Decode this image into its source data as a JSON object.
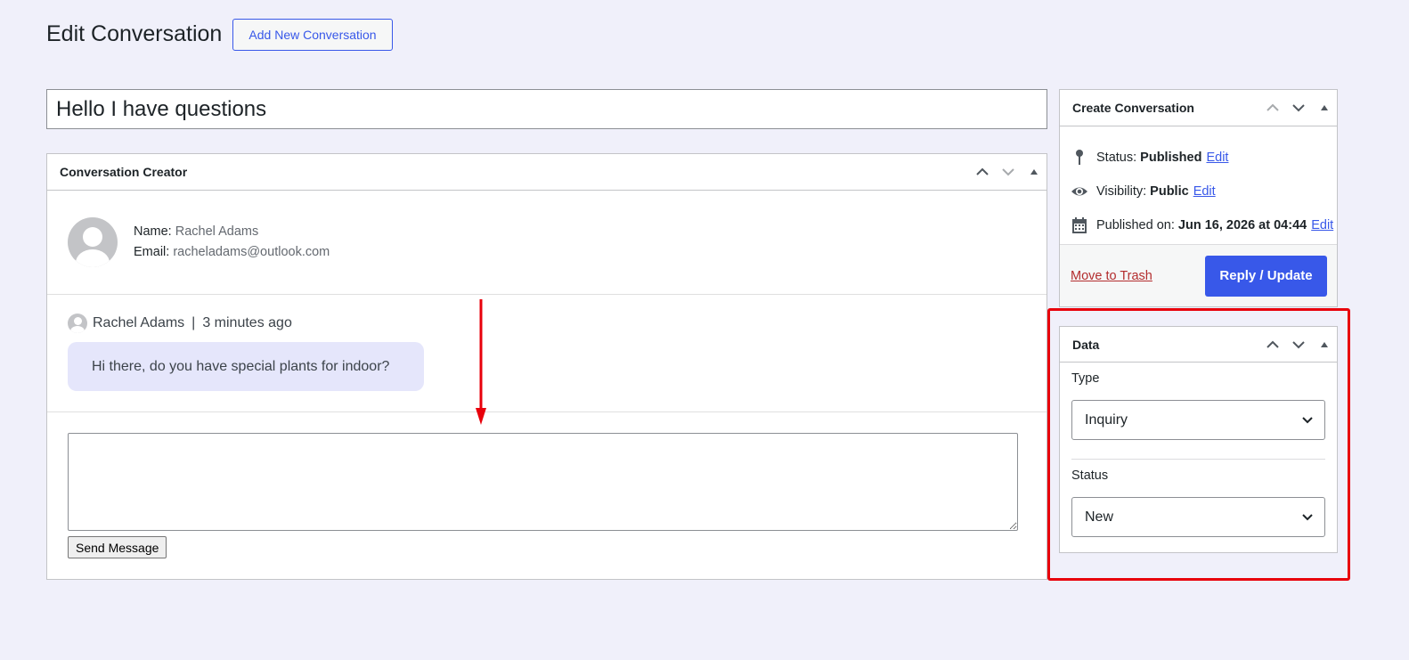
{
  "page": {
    "title": "Edit Conversation",
    "add_new_label": "Add New Conversation",
    "post_title": "Hello I have questions"
  },
  "creator_box": {
    "title": "Conversation Creator",
    "name_label": "Name:",
    "name_value": "Rachel Adams",
    "email_label": "Email:",
    "email_value": "racheladams@outlook.com",
    "message": {
      "author": "Rachel Adams",
      "separator": "|",
      "time": "3 minutes ago",
      "text": "Hi there, do you have special plants for indoor?"
    },
    "reply_placeholder": "",
    "send_label": "Send Message"
  },
  "publish_box": {
    "title": "Create Conversation",
    "status_label": "Status:",
    "status_value": "Published",
    "visibility_label": "Visibility:",
    "visibility_value": "Public",
    "published_label": "Published on:",
    "published_value": "Jun 16, 2026 at 04:44",
    "edit_label": "Edit",
    "trash_label": "Move to Trash",
    "update_label": "Reply / Update"
  },
  "data_box": {
    "title": "Data",
    "type_label": "Type",
    "type_value": "Inquiry",
    "status_label": "Status",
    "status_value": "New"
  },
  "icons": {
    "pin": "pin-icon",
    "eye": "eye-icon",
    "calendar": "calendar-icon",
    "up": "chevron-up-icon",
    "down": "chevron-down-icon",
    "toggle": "triangle-up-icon"
  },
  "colors": {
    "accent": "#3858e9",
    "background": "#f0f0fa",
    "bubble": "#e5e6fb",
    "annotation": "#e8000b",
    "trash": "#b32d2e"
  }
}
